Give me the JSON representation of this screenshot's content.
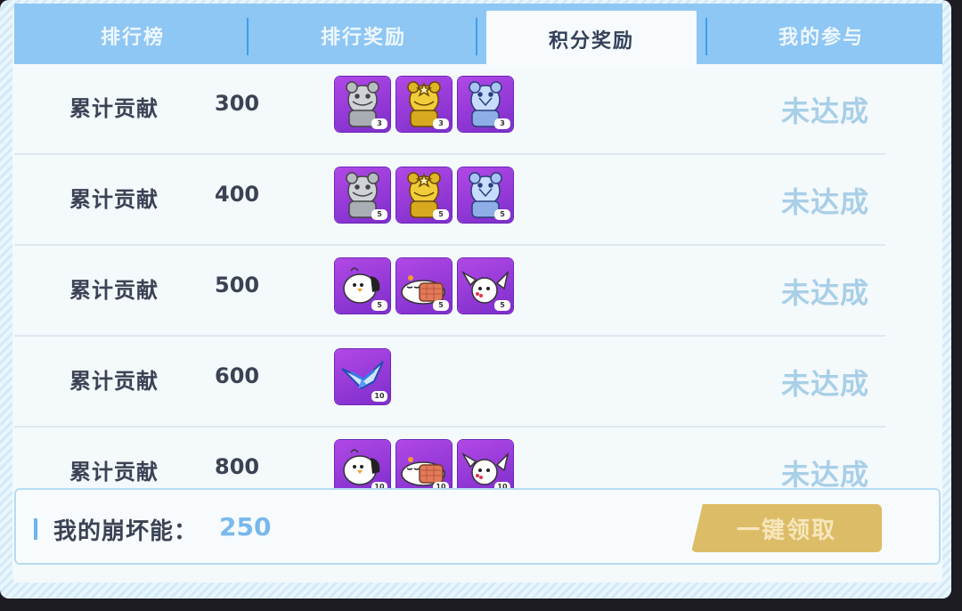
{
  "tabs": [
    {
      "label": "排行榜",
      "active": false
    },
    {
      "label": "排行奖励",
      "active": false
    },
    {
      "label": "积分奖励",
      "active": true
    },
    {
      "label": "我的参与",
      "active": false
    }
  ],
  "rows": [
    {
      "label": "累计贡献",
      "value": "300",
      "status": "未达成",
      "items": [
        {
          "icon": "silver-bear-statue-icon",
          "count": "3"
        },
        {
          "icon": "gold-bear-statue-icon",
          "count": "3"
        },
        {
          "icon": "crystal-bear-statue-icon",
          "count": "3"
        }
      ]
    },
    {
      "label": "累计贡献",
      "value": "400",
      "status": "未达成",
      "items": [
        {
          "icon": "silver-bear-statue-icon",
          "count": "5"
        },
        {
          "icon": "gold-bear-statue-icon",
          "count": "5"
        },
        {
          "icon": "crystal-bear-statue-icon",
          "count": "5"
        }
      ]
    },
    {
      "label": "累计贡献",
      "value": "500",
      "status": "未达成",
      "items": [
        {
          "icon": "white-bird-icon",
          "count": "5"
        },
        {
          "icon": "sleeping-chick-icon",
          "count": "5"
        },
        {
          "icon": "flying-bird-icon",
          "count": "5"
        }
      ]
    },
    {
      "label": "累计贡献",
      "value": "600",
      "status": "未达成",
      "items": [
        {
          "icon": "blue-wing-emblem-icon",
          "count": "10"
        }
      ]
    },
    {
      "label": "累计贡献",
      "value": "800",
      "status": "未达成",
      "items": [
        {
          "icon": "white-bird-icon",
          "count": "10"
        },
        {
          "icon": "sleeping-chick-icon",
          "count": "10"
        },
        {
          "icon": "flying-bird-icon",
          "count": "10"
        }
      ]
    }
  ],
  "footer": {
    "label": "我的崩坏能：",
    "value": "250",
    "claim_label": "一键领取"
  },
  "colors": {
    "tab_bar": "#8ec6f4",
    "item_bg": "#9a3cdb",
    "status": "#a8cfe7",
    "claim": "#dcbc66",
    "accent_value": "#79b8ee"
  }
}
